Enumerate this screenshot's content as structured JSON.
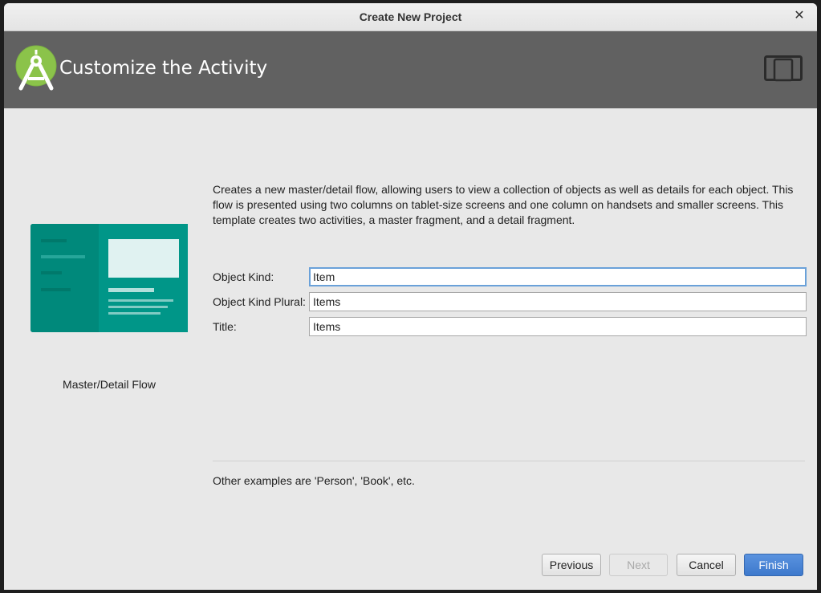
{
  "window": {
    "title": "Create New Project",
    "close_icon": "close-icon"
  },
  "header": {
    "title": "Customize the Activity",
    "logo_icon": "android-studio-logo-icon",
    "device_icon": "tablet-phone-icon",
    "background_color": "#616161"
  },
  "preview": {
    "caption": "Master/Detail Flow",
    "accent_color": "#00897b"
  },
  "description": "Creates a new master/detail flow, allowing users to view a collection of objects as well as details for each object. This flow is presented using two columns on tablet-size screens and one column on handsets and smaller screens. This template creates two activities, a master fragment, and a detail fragment.",
  "form": {
    "object_kind": {
      "label": "Object Kind:",
      "value": "Item"
    },
    "object_kind_plural": {
      "label": "Object Kind Plural:",
      "value": "Items"
    },
    "title": {
      "label": "Title:",
      "value": "Items"
    }
  },
  "hint": "Other examples are 'Person', 'Book', etc.",
  "buttons": {
    "previous": "Previous",
    "next": "Next",
    "cancel": "Cancel",
    "finish": "Finish",
    "finish_color": "#4a86d6"
  }
}
